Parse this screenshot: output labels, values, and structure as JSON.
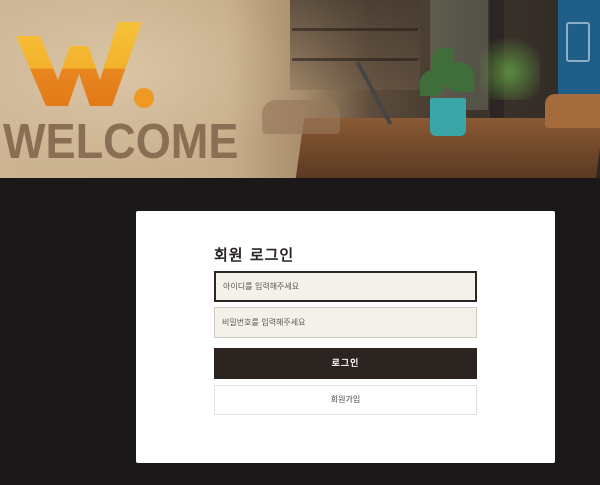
{
  "banner": {
    "logo_letter": "W",
    "welcome_text": "WELCOME"
  },
  "login": {
    "title": "회원 로그인",
    "id_placeholder": "아이디를 입력해주세요",
    "pw_placeholder": "비밀번호를 입력해주세요",
    "login_label": "로그인",
    "signup_label": "회원가입"
  },
  "colors": {
    "page_background": "#1a1818",
    "logo_yellow": "#f2b22a",
    "logo_orange": "#e8861f",
    "welcome_brown": "#8a6f54",
    "button_dark": "#2b2420",
    "field_background": "#f4f1eb"
  }
}
